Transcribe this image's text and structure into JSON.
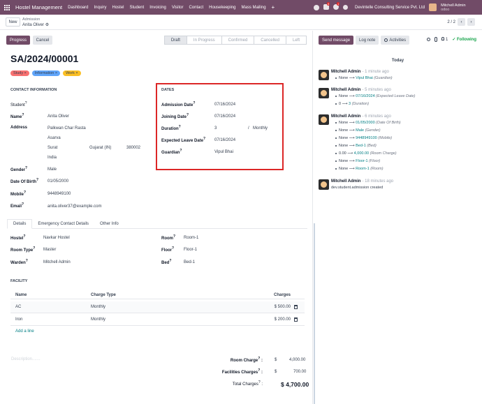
{
  "app": {
    "brand": "Hostel Management",
    "menu": [
      "Dashboard",
      "Inquiry",
      "Hostel",
      "Student",
      "Invoicing",
      "Visitor",
      "Contact",
      "Housekeeping",
      "Mass Mailing"
    ],
    "plus": "+",
    "company": "Devintelle Consulting Service Pvt. Ltd",
    "user_name": "Mitchell Admin",
    "user_sub": "odoo",
    "badges": [
      "5",
      "1"
    ]
  },
  "control": {
    "new_label": "New",
    "breadcrumb_parent": "Admission",
    "breadcrumb_current": "Anita Oliver",
    "gear": "⚙",
    "pager": "2 / 2",
    "prev": "‹",
    "next": "›"
  },
  "actions": {
    "progress": "Progress",
    "cancel": "Cancel"
  },
  "status_bar": [
    "Draft",
    "In Progress",
    "Confirmed",
    "Cancelled",
    "Left"
  ],
  "status_active": "Draft",
  "record": {
    "title": "SA/2024/00001",
    "tags": [
      {
        "label": "Study",
        "color": "#f87171"
      },
      {
        "label": "Information",
        "color": "#60a5fa"
      },
      {
        "label": "Work",
        "color": "#fbbf24"
      }
    ],
    "tag_x": "×"
  },
  "contact": {
    "section": "CONTACT INFORMATION",
    "student_label": "Student",
    "name_label": "Name",
    "name": "Anita Oliver",
    "address_label": "Address",
    "street": "Palkwan Char Rasta",
    "street2": "Asarva",
    "city": "Surat",
    "state": "Gujarat (IN)",
    "zip": "380002",
    "country": "India",
    "gender_label": "Gender",
    "gender": "Male",
    "dob_label": "Date Of Birth",
    "dob": "01/05/2000",
    "mobile_label": "Mobile",
    "mobile": "9448949100",
    "email_label": "Email",
    "email": "anita.oliver37@example.com",
    "help": "?"
  },
  "dates": {
    "section": "DATES",
    "admission_label": "Admission Date",
    "admission": "07/16/2024",
    "joining_label": "Joining Date",
    "joining": "07/16/2024",
    "duration_label": "Duration",
    "duration": "3",
    "duration_sep": "/",
    "duration_unit": "Monthly",
    "leave_label": "Expected Leave Date",
    "leave": "07/16/2024",
    "guardian_label": "Guardian",
    "guardian": "Vipul Bhai"
  },
  "tabs": [
    "Details",
    "Emergency Contact Details",
    "Other Info"
  ],
  "details": {
    "hostel_label": "Hostel",
    "hostel": "Navkar Hostel",
    "roomtype_label": "Room Type",
    "roomtype": "Master",
    "warden_label": "Warden",
    "warden": "Mitchell Admin",
    "room_label": "Room",
    "room": "Room-1",
    "floor_label": "Floor",
    "floor": "Floor-1",
    "bed_label": "Bed",
    "bed": "Bed-1"
  },
  "facility": {
    "section": "FACILITY",
    "columns": [
      "Name",
      "Charge Type",
      "Charges"
    ],
    "rows": [
      {
        "name": "AC",
        "type": "Monthly",
        "charge": "$ 500.00"
      },
      {
        "name": "Iron",
        "type": "Monthly",
        "charge": "$ 200.00"
      }
    ],
    "add_line": "Add a line"
  },
  "summary": {
    "description_placeholder": "Description.......",
    "room_charge_label": "Room Charge",
    "room_charge": "4,000.00",
    "facility_label": "Facilities Charges",
    "facility": "700.00",
    "total_label": "Total Charges",
    "total": "$ 4,700.00",
    "currency": "$",
    "colon": ":"
  },
  "chatter": {
    "send": "Send message",
    "log": "Log note",
    "activities": "Activities",
    "follow_count": "1",
    "following": "✓ Following",
    "today": "Today",
    "messages": [
      {
        "author": "Mitchell Admin",
        "time": "- 1 minute ago",
        "lines": [
          {
            "old": "None",
            "new": "Vipul Bhai",
            "field": "(Guardian)"
          }
        ]
      },
      {
        "author": "Mitchell Admin",
        "time": "- 5 minutes ago",
        "lines": [
          {
            "old": "None",
            "new": "07/16/2024",
            "field": "(Expected Leave Date)"
          },
          {
            "old": "0",
            "new": "3",
            "field": "(Duration)"
          }
        ]
      },
      {
        "author": "Mitchell Admin",
        "time": "- 6 minutes ago",
        "lines": [
          {
            "old": "None",
            "new": "01/05/2000",
            "field": "(Date Of Birth)"
          },
          {
            "old": "None",
            "new": "Male",
            "field": "(Gender)"
          },
          {
            "old": "None",
            "new": "9448949100",
            "field": "(Mobile)"
          },
          {
            "old": "None",
            "new": "Bed-1",
            "field": "(Bed)"
          },
          {
            "old": "0.00",
            "new": "4,000.00",
            "field": "(Room Charge)"
          },
          {
            "old": "None",
            "new": "Floor-1",
            "field": "(Floor)"
          },
          {
            "old": "None",
            "new": "Room-1",
            "field": "(Room)"
          }
        ]
      },
      {
        "author": "Mitchell Admin",
        "time": "- 18 minutes ago",
        "body": "dev.student.admission created"
      }
    ],
    "arrow": "⟶"
  }
}
